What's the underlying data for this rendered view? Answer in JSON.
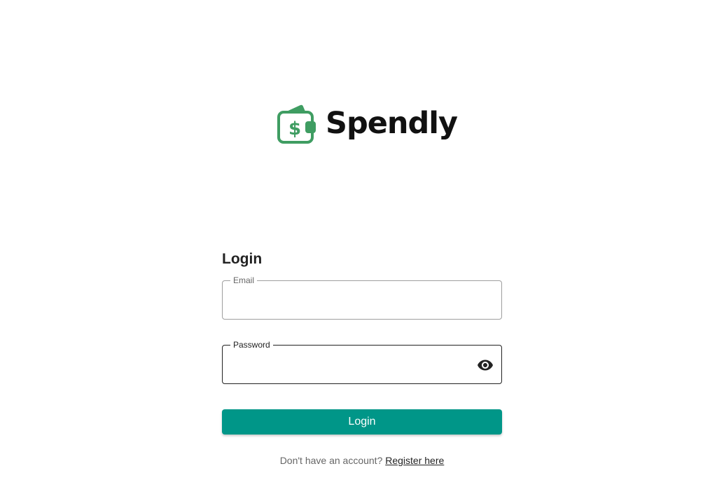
{
  "brand": {
    "name": "Spendly",
    "icon": "wallet-dollar-icon",
    "accent_color": "#3f9d62"
  },
  "login_form": {
    "title": "Login",
    "email": {
      "label": "Email",
      "value": "",
      "placeholder": ""
    },
    "password": {
      "label": "Password",
      "value": "",
      "placeholder": "",
      "toggle_icon": "eye-icon"
    },
    "submit_label": "Login",
    "submit_color": "#009688",
    "register_prompt": "Don't have an account?",
    "register_link": "Register here"
  }
}
